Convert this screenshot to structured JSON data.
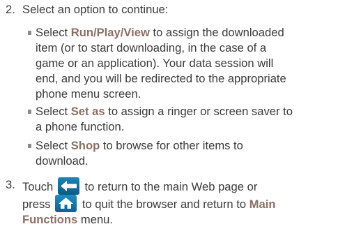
{
  "step2": {
    "number": "2.",
    "text": "Select an option to continue:",
    "options": [
      {
        "prefix": "Select ",
        "keyword": "Run/Play/View",
        "line_rest": " to assign the downloaded",
        "lines": [
          "item (or to start downloading, in the case of a",
          "game or an application). Your data session will",
          "end, and you will be redirected to the appropriate",
          "phone menu screen."
        ]
      },
      {
        "prefix": "Select ",
        "keyword": "Set as",
        "line_rest": " to assign a ringer or screen saver to",
        "lines": [
          "a phone function."
        ]
      },
      {
        "prefix": "Select ",
        "keyword": "Shop",
        "line_rest": " to browse for other items to",
        "lines": [
          "download."
        ]
      }
    ]
  },
  "step3": {
    "number": "3.",
    "touch": "Touch",
    "after_back": "to return to the main Web page or",
    "press": "press",
    "after_home": "to quit the browser and return to",
    "menu_keyword_1": "Main",
    "menu_keyword_2": "Functions",
    "menu_suffix": "menu.",
    "back_icon": "back-arrow-icon",
    "home_icon": "home-icon"
  },
  "colors": {
    "text": "#3a3a3a",
    "keyword": "#8b6f65",
    "bullet": "#8a8a8a",
    "icon_blue": "#0e6e9e"
  }
}
